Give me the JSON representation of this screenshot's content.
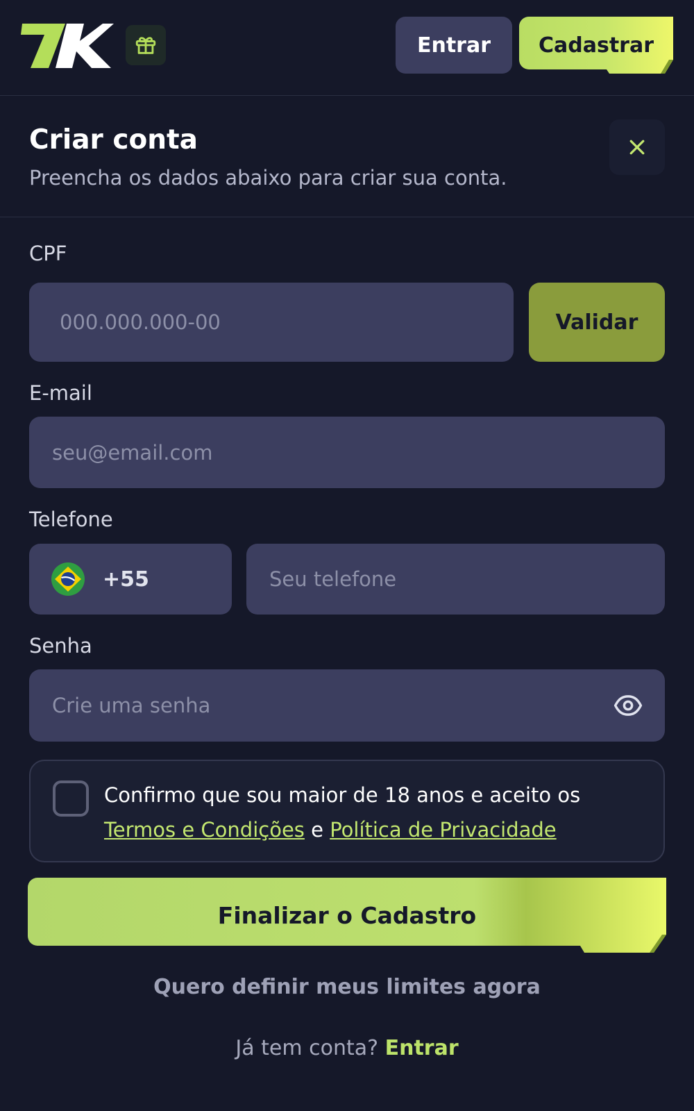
{
  "header": {
    "logo_text": "7K",
    "login_label": "Entrar",
    "register_label": "Cadastrar"
  },
  "panel": {
    "title": "Criar conta",
    "subtitle": "Preencha os dados abaixo para criar sua conta."
  },
  "form": {
    "cpf": {
      "label": "CPF",
      "placeholder": "000.000.000-00",
      "value": "",
      "validate_label": "Validar"
    },
    "email": {
      "label": "E-mail",
      "placeholder": "seu@email.com",
      "value": ""
    },
    "phone": {
      "label": "Telefone",
      "country_code": "+55",
      "placeholder": "Seu telefone",
      "value": ""
    },
    "password": {
      "label": "Senha",
      "placeholder": "Crie uma senha",
      "value": ""
    },
    "consent": {
      "checked": false,
      "text": "Confirmo que sou maior de 18 anos e aceito os",
      "terms_link": "Termos e Condições",
      "conjunction": "e",
      "privacy_link": "Política de Privacidade"
    },
    "submit_label": "Finalizar o Cadastro",
    "limits_link": "Quero definir meus limites agora",
    "login_prompt": "Já tem conta?",
    "login_link": "Entrar"
  },
  "icons": {
    "gift": "gift-icon",
    "close": "close-icon",
    "flag": "brazil-flag-icon",
    "eye": "eye-icon"
  },
  "colors": {
    "background": "#151829",
    "surface": "#3c3e5f",
    "accent": "#c4e870",
    "accent_dark": "#8a9c3c"
  }
}
